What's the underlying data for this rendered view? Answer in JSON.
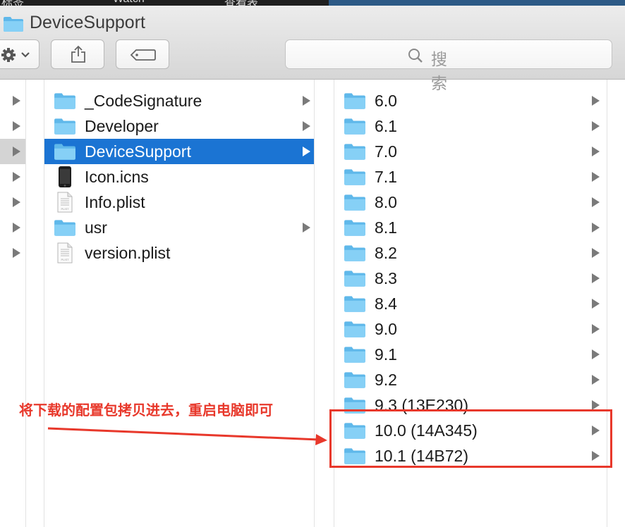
{
  "menubar": {
    "items": [
      "标签",
      "Watch",
      "查看表"
    ]
  },
  "window": {
    "title": "DeviceSupport"
  },
  "toolbar": {
    "action_icon": "gear-icon",
    "share_icon": "share-icon",
    "tag_icon": "tag-icon",
    "search_placeholder": "搜索"
  },
  "column1": {
    "rows": 7,
    "selected_index": 2
  },
  "column2": {
    "items": [
      {
        "name": "_CodeSignature",
        "icon": "folder-icon",
        "has_children": true
      },
      {
        "name": "Developer",
        "icon": "folder-icon",
        "has_children": true
      },
      {
        "name": "DeviceSupport",
        "icon": "folder-icon",
        "has_children": true,
        "selected": true
      },
      {
        "name": "Icon.icns",
        "icon": "iphone-icon",
        "has_children": false
      },
      {
        "name": "Info.plist",
        "icon": "plist-file-icon",
        "has_children": false
      },
      {
        "name": "usr",
        "icon": "folder-icon",
        "has_children": true
      },
      {
        "name": "version.plist",
        "icon": "plist-file-icon",
        "has_children": false
      }
    ]
  },
  "column3": {
    "items": [
      {
        "name": "6.0"
      },
      {
        "name": "6.1"
      },
      {
        "name": "7.0"
      },
      {
        "name": "7.1"
      },
      {
        "name": "8.0"
      },
      {
        "name": "8.1"
      },
      {
        "name": "8.2"
      },
      {
        "name": "8.3"
      },
      {
        "name": "8.4"
      },
      {
        "name": "9.0"
      },
      {
        "name": "9.1"
      },
      {
        "name": "9.2"
      },
      {
        "name": "9.3 (13E230)"
      },
      {
        "name": "10.0 (14A345)"
      },
      {
        "name": "10.1 (14B72)"
      }
    ]
  },
  "annotation": {
    "text": "将下载的配置包拷贝进去，重启电脑即可",
    "color": "#e8382b"
  },
  "colors": {
    "selection": "#1b74d3",
    "folder": "#6cc3f0"
  }
}
